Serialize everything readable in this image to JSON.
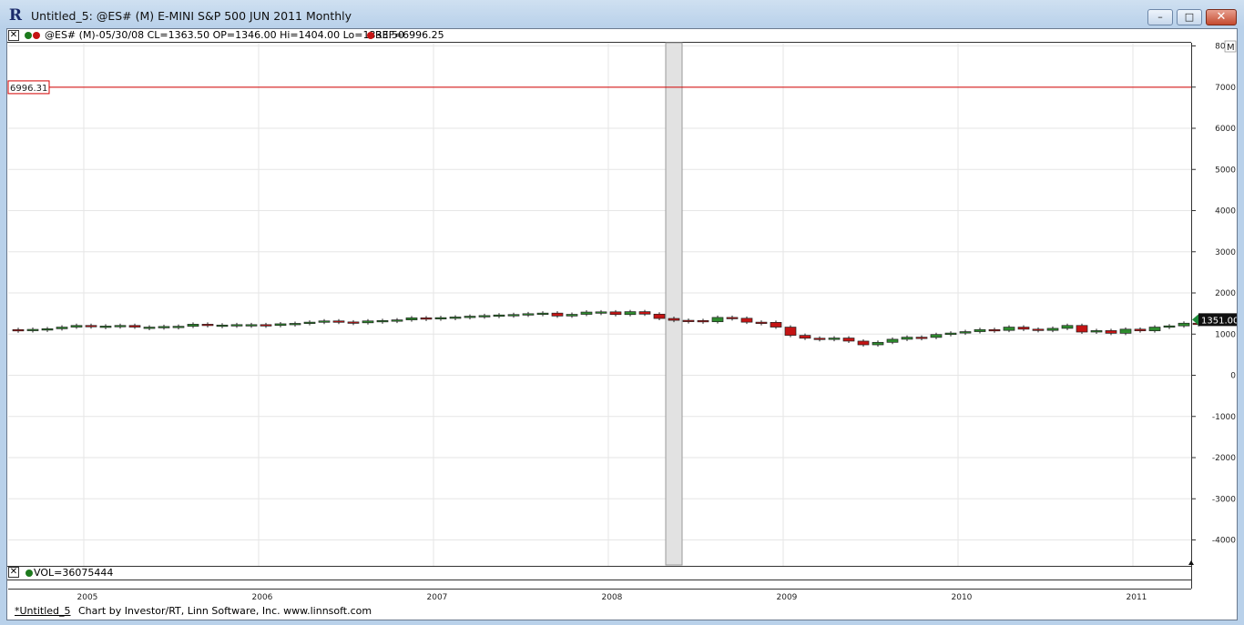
{
  "window": {
    "title": "Untitled_5: @ES# (M) E-MINI S&P 500 JUN 2011 Monthly",
    "app_icon": "R",
    "minimize_label": "–",
    "maximize_label": "□",
    "close_label": "✕"
  },
  "price_pane": {
    "close_glyph": "✕",
    "symbol_info": "@ES# (M)-05/30/08 CL=1363.50 OP=1346.00 Hi=1404.00 Lo=1333.50",
    "ref_info": "REF=6996.25",
    "ref_line_label": "6996.31",
    "last_price_label": "1351.00",
    "pane_mode_label": "M",
    "colors": {
      "up": "#2e8b2e",
      "down": "#c41414",
      "ref": "#d40000",
      "grid": "#e6e6e6",
      "cursor": "#e2e2e2"
    }
  },
  "volume_pane": {
    "close_glyph": "✕",
    "info": "VOL=36075444"
  },
  "status_bar": {
    "tab_label": "*Untitled_5",
    "credit": "Chart by Investor/RT, Linn Software, Inc. www.linnsoft.com"
  },
  "chart_data": {
    "type": "candlestick",
    "y_ticks": [
      8000,
      7000,
      6000,
      5000,
      4000,
      3000,
      2000,
      1000,
      0,
      -1000,
      -2000,
      -3000,
      -4000
    ],
    "ylim": [
      -4400,
      8100
    ],
    "x_labels": [
      "2005",
      "2006",
      "2007",
      "2008",
      "2009",
      "2010",
      "2011"
    ],
    "reference_line": 6996.31,
    "last_price": 1351.0,
    "highlighted_bar": "2008-05",
    "start_month": "2004-08",
    "closes": [
      1105,
      1115,
      1130,
      1170,
      1210,
      1180,
      1195,
      1210,
      1170,
      1170,
      1185,
      1190,
      1240,
      1215,
      1220,
      1230,
      1230,
      1210,
      1250,
      1260,
      1290,
      1320,
      1295,
      1275,
      1320,
      1330,
      1345,
      1395,
      1380,
      1400,
      1415,
      1435,
      1450,
      1465,
      1475,
      1495,
      1510,
      1440,
      1480,
      1535,
      1540,
      1475,
      1545,
      1485,
      1380,
      1335,
      1330,
      1300,
      1405,
      1385,
      1290,
      1285,
      1170,
      970,
      900,
      870,
      905,
      830,
      740,
      800,
      875,
      925,
      920,
      990,
      1025,
      1060,
      1110,
      1090,
      1170,
      1120,
      1090,
      1140,
      1210,
      1050,
      1085,
      1020,
      1120,
      1080,
      1170,
      1200,
      1265,
      1260,
      1285,
      1335,
      1325,
      1351
    ],
    "opens": [
      1110,
      1105,
      1115,
      1130,
      1170,
      1210,
      1180,
      1195,
      1210,
      1170,
      1170,
      1185,
      1190,
      1240,
      1215,
      1220,
      1230,
      1230,
      1210,
      1250,
      1260,
      1290,
      1320,
      1295,
      1275,
      1320,
      1330,
      1345,
      1395,
      1380,
      1400,
      1415,
      1435,
      1450,
      1465,
      1475,
      1495,
      1510,
      1440,
      1480,
      1535,
      1540,
      1475,
      1545,
      1485,
      1380,
      1335,
      1330,
      1300,
      1405,
      1385,
      1290,
      1285,
      1170,
      970,
      900,
      870,
      905,
      830,
      740,
      800,
      875,
      925,
      920,
      990,
      1025,
      1060,
      1110,
      1090,
      1170,
      1120,
      1090,
      1140,
      1210,
      1050,
      1085,
      1020,
      1120,
      1080,
      1170,
      1200,
      1265,
      1260,
      1285,
      1335,
      1325
    ]
  }
}
